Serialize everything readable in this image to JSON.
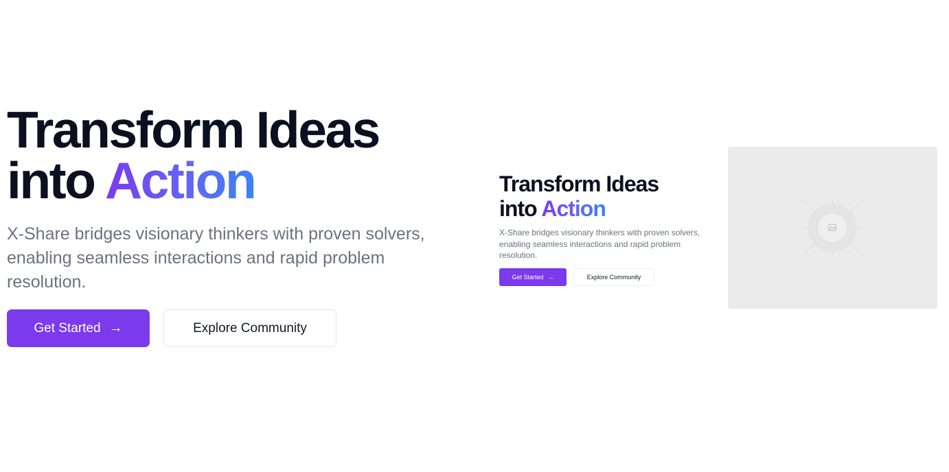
{
  "hero": {
    "title_line1": "Transform Ideas",
    "title_line2_prefix": "into ",
    "title_line2_highlight": "Action",
    "subtitle": "X-Share bridges visionary thinkers with proven solvers, enabling seamless interactions and rapid problem resolution.",
    "primary_button": "Get Started",
    "primary_button_icon": "arrow-right-icon",
    "secondary_button": "Explore Community"
  },
  "preview": {
    "title_line1": "Transform Ideas",
    "title_line2_prefix": "into ",
    "title_line2_highlight": "Action",
    "subtitle": "X-Share bridges visionary thinkers with proven solvers, enabling seamless interactions and rapid problem resolution.",
    "primary_button": "Get Started",
    "secondary_button": "Explore Community"
  },
  "image_placeholder": {
    "icon": "image-icon"
  },
  "colors": {
    "accent": "#7c3aed",
    "gradient_start": "#7c3aed",
    "gradient_end": "#3b82f6",
    "heading": "#0b1020",
    "body_text": "#6b7280",
    "placeholder_bg": "#ebebeb"
  }
}
